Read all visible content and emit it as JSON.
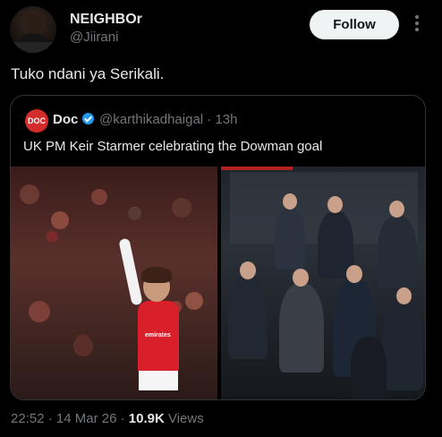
{
  "author": {
    "name": "NEIGHBOr",
    "handle": "@Jiirani",
    "follow_label": "Follow"
  },
  "tweet": {
    "text": "Tuko ndani ya Serikali."
  },
  "quoted": {
    "avatar_text": "DOC",
    "name": "Doc",
    "handle": "@karthikadhaigal · 13h",
    "text": "UK PM Keir Starmer celebrating the Dowman goal",
    "sponsor": "emirates"
  },
  "meta": {
    "time": "22:52",
    "date": "14 Mar 26",
    "views": "10.9K",
    "views_label": "Views"
  }
}
